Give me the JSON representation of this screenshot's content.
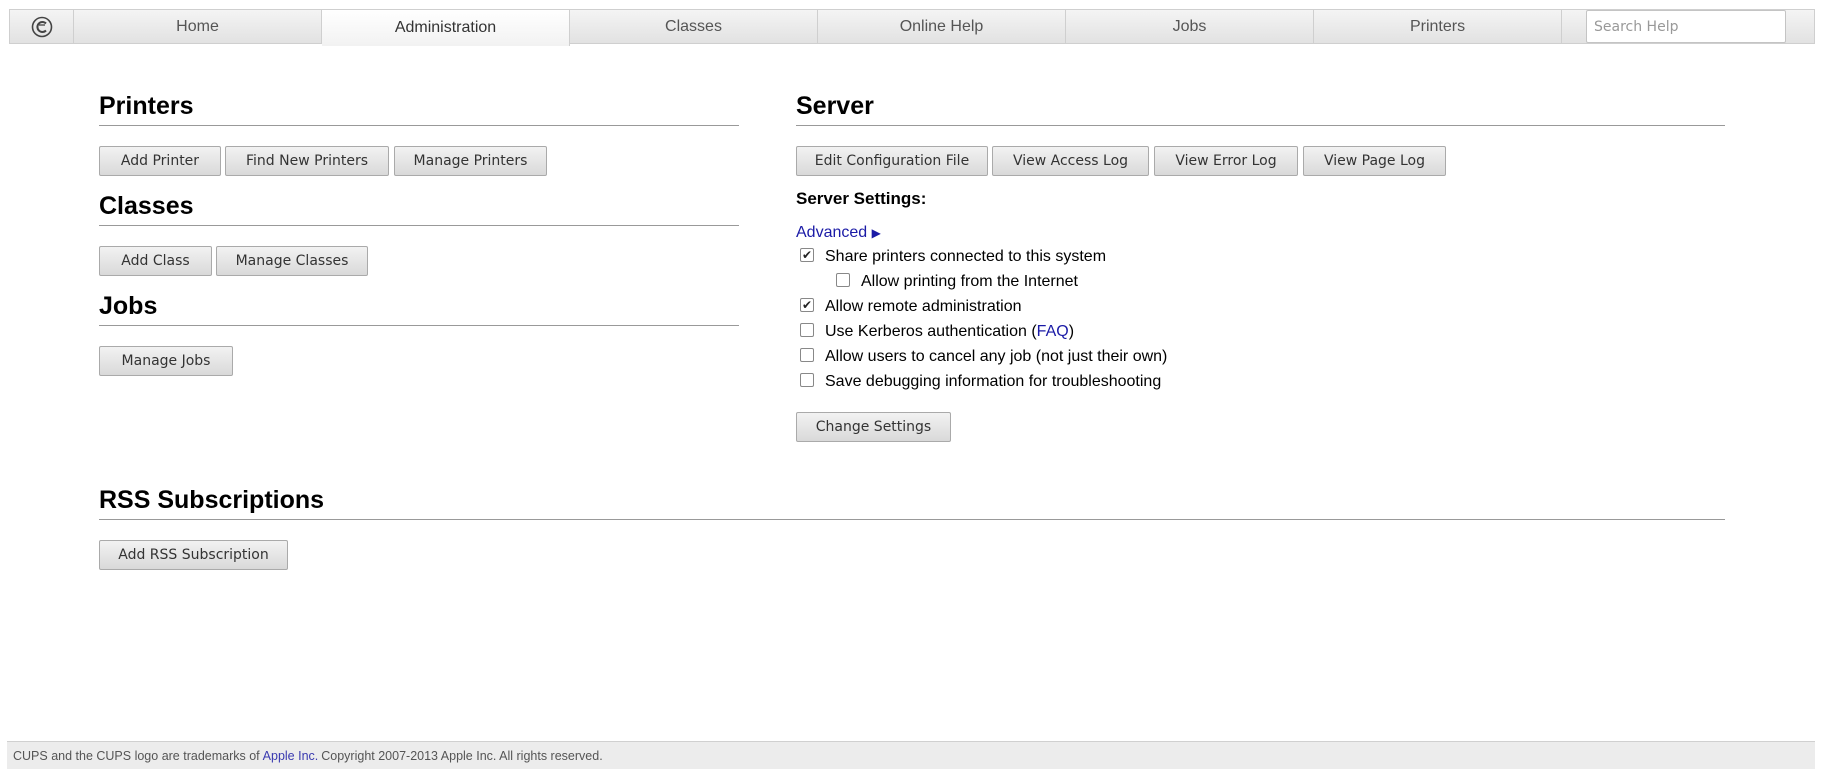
{
  "nav": {
    "tabs": [
      {
        "label": "Home",
        "active": false
      },
      {
        "label": "Administration",
        "active": true
      },
      {
        "label": "Classes",
        "active": false
      },
      {
        "label": "Online Help",
        "active": false
      },
      {
        "label": "Jobs",
        "active": false
      },
      {
        "label": "Printers",
        "active": false
      }
    ],
    "search_placeholder": "Search Help",
    "logo_icon": "cups-logo-icon"
  },
  "printers": {
    "title": "Printers",
    "buttons": [
      "Add Printer",
      "Find New Printers",
      "Manage Printers"
    ]
  },
  "classes": {
    "title": "Classes",
    "buttons": [
      "Add Class",
      "Manage Classes"
    ]
  },
  "jobs": {
    "title": "Jobs",
    "buttons": [
      "Manage Jobs"
    ]
  },
  "server": {
    "title": "Server",
    "buttons": [
      "Edit Configuration File",
      "View Access Log",
      "View Error Log",
      "View Page Log"
    ],
    "settings_label": "Server Settings:",
    "advanced_label": "Advanced",
    "advanced_icon": "triangle-right-icon",
    "options": [
      {
        "label": "Share printers connected to this system",
        "checked": true
      },
      {
        "label": "Allow printing from the Internet",
        "checked": false
      },
      {
        "label": "Allow remote administration",
        "checked": true
      },
      {
        "label_before": "Use Kerberos authentication (",
        "link": "FAQ",
        "label_after": ")",
        "checked": false
      },
      {
        "label": "Allow users to cancel any job (not just their own)",
        "checked": false
      },
      {
        "label": "Save debugging information for troubleshooting",
        "checked": false
      }
    ],
    "change_button": "Change Settings"
  },
  "rss": {
    "title": "RSS Subscriptions",
    "button": "Add RSS Subscription"
  },
  "footer": {
    "text_before": "CUPS and the CUPS logo are trademarks of",
    "link": "Apple Inc.",
    "text_after": "Copyright 2007-2013 Apple Inc. All rights reserved."
  },
  "colors": {
    "link": "#1a1aa6",
    "nav_bg": "#e8e8e8",
    "button_bg": "#e2e2e2"
  }
}
